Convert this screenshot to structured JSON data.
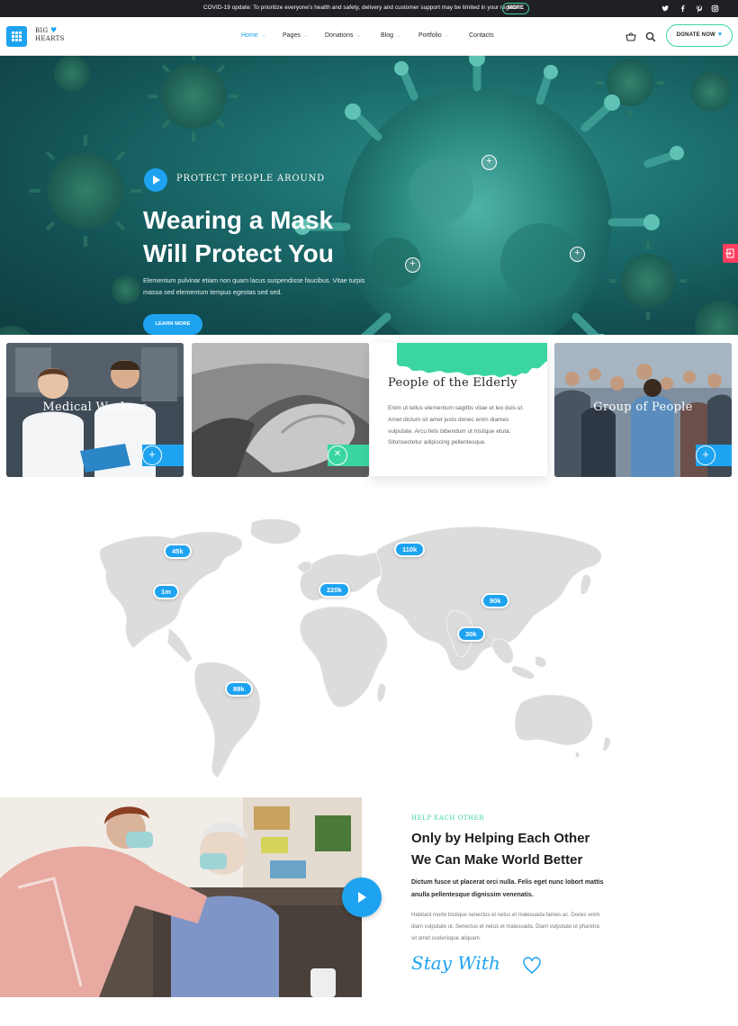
{
  "topbar": {
    "message": "COVID-19 update: To prioritize everyone's health and safety, delivery and customer support may be limited in your region.",
    "more_label": "MORE",
    "social_icons": [
      "twitter-icon",
      "facebook-icon",
      "pinterest-icon",
      "instagram-icon"
    ]
  },
  "header": {
    "logo_line1": "BIG",
    "logo_line2": "HEARTS",
    "nav": [
      {
        "label": "Home"
      },
      {
        "label": "Pages"
      },
      {
        "label": "Donations"
      },
      {
        "label": "Blog"
      },
      {
        "label": "Portfolio"
      },
      {
        "label": "Contacts"
      }
    ],
    "donate_label": "DONATE NOW",
    "accent": "#1ea3f0",
    "secondary_accent": "#3bd6a0"
  },
  "hero": {
    "kicker": "PROTECT PEOPLE AROUND",
    "title_line1": "Wearing a Mask",
    "title_line2": "Will Protect You",
    "text": "Elementum pulvinar etiam non quam lacus suspendisse faucibus. Vitae turpis massa sed elementum tempus egestas sed sed.",
    "cta": "LEARN MORE"
  },
  "cards": {
    "card1_label": "Medical Workers",
    "card3_title": "People of the Elderly",
    "card3_text": "Enim ut tellus elementum sagittis vitae et leo duis ut. Amet dictum sit amet justo donec enim diames vulputate. Arcu felis bibendum ut tristique etuta. Sitonsectetur adipiscing pellentesque.",
    "card4_label": "Group of People"
  },
  "map": {
    "pins": [
      "45k",
      "1m",
      "220k",
      "110k",
      "90k",
      "30k",
      "89k"
    ]
  },
  "about": {
    "kicker": "Help Each Other",
    "title_line1": "Only by Helping Each Other",
    "title_line2": "We Can Make World Better",
    "lead": "Dictum fusce ut placerat orci nulla. Felis eget nunc lobort mattis anulla pellentesque dignissim venenatis.",
    "text": "Habitant morbi tristique senectus et netus et malesuada fames ac. Donec enim diam vulputate ut. Senectus et netus et malesuada. Diam vulputate ut pharetra sit amet scelerisque aliquam.",
    "signature": "Stay With"
  }
}
